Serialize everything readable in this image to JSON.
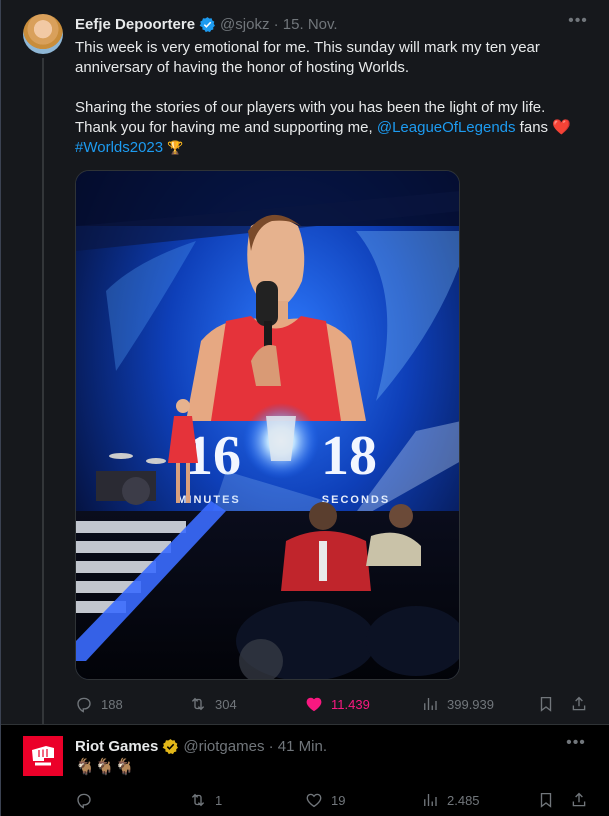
{
  "tweet": {
    "author_name": "Eefje Depoortere",
    "handle": "@sjokz",
    "date": "15. Nov.",
    "line1": "This week is very emotional for me. This sunday will mark my ten year anniversary of having the honor of hosting Worlds.",
    "line2_prefix": "Sharing the stories of our players with you has been the light of my life. Thank you for having me and supporting me, ",
    "mention": "@LeagueOfLegends",
    "line2_suffix": " fans ",
    "heart_emoji": "❤️",
    "hashtag": "#Worlds2023",
    "trophy_emoji": "🏆",
    "media": {
      "countdown_minutes": "16",
      "countdown_seconds": "18",
      "minutes_label": "MINUTES",
      "seconds_label": "SECONDS"
    },
    "stats": {
      "replies": "188",
      "reposts": "304",
      "likes": "11.439",
      "views": "399.939"
    }
  },
  "reply": {
    "author_name": "Riot Games",
    "handle": "@riotgames",
    "time": "41 Min.",
    "text": "🐐🐐🐐",
    "stats": {
      "replies": "",
      "reposts": "1",
      "likes": "19",
      "views": "2.485"
    }
  },
  "colors": {
    "accent": "#1d9bf0",
    "like_pink": "#f91880",
    "verified_gold": "#e2b719",
    "riot_red": "#eb0029"
  },
  "icons": [
    "reply-icon",
    "repost-icon",
    "like-icon",
    "views-icon",
    "bookmark-icon",
    "share-icon",
    "verified-badge-icon",
    "more-icon"
  ]
}
